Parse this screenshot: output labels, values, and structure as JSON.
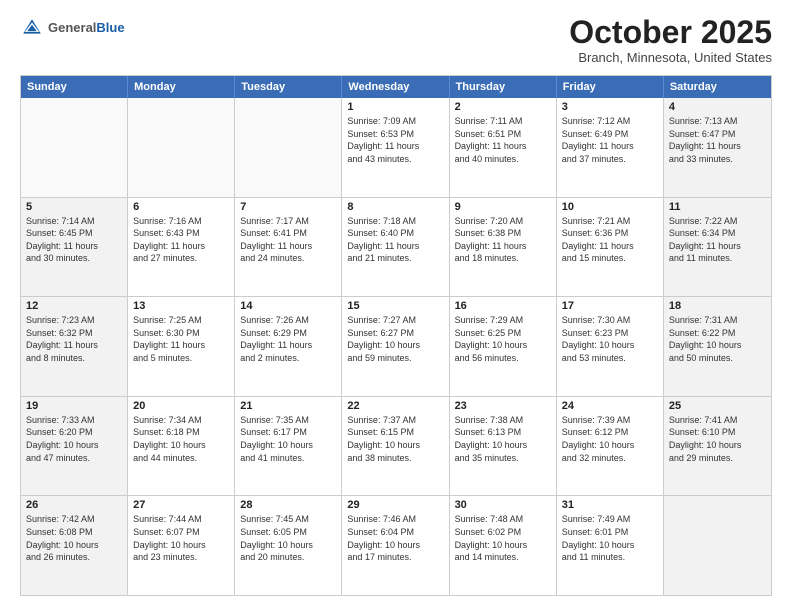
{
  "header": {
    "logo_general": "General",
    "logo_blue": "Blue",
    "month_title": "October 2025",
    "location": "Branch, Minnesota, United States"
  },
  "weekdays": [
    "Sunday",
    "Monday",
    "Tuesday",
    "Wednesday",
    "Thursday",
    "Friday",
    "Saturday"
  ],
  "rows": [
    [
      {
        "day": "",
        "text": "",
        "shaded": false,
        "empty": true
      },
      {
        "day": "",
        "text": "",
        "shaded": false,
        "empty": true
      },
      {
        "day": "",
        "text": "",
        "shaded": false,
        "empty": true
      },
      {
        "day": "1",
        "text": "Sunrise: 7:09 AM\nSunset: 6:53 PM\nDaylight: 11 hours\nand 43 minutes.",
        "shaded": false
      },
      {
        "day": "2",
        "text": "Sunrise: 7:11 AM\nSunset: 6:51 PM\nDaylight: 11 hours\nand 40 minutes.",
        "shaded": false
      },
      {
        "day": "3",
        "text": "Sunrise: 7:12 AM\nSunset: 6:49 PM\nDaylight: 11 hours\nand 37 minutes.",
        "shaded": false
      },
      {
        "day": "4",
        "text": "Sunrise: 7:13 AM\nSunset: 6:47 PM\nDaylight: 11 hours\nand 33 minutes.",
        "shaded": true
      }
    ],
    [
      {
        "day": "5",
        "text": "Sunrise: 7:14 AM\nSunset: 6:45 PM\nDaylight: 11 hours\nand 30 minutes.",
        "shaded": true
      },
      {
        "day": "6",
        "text": "Sunrise: 7:16 AM\nSunset: 6:43 PM\nDaylight: 11 hours\nand 27 minutes.",
        "shaded": false
      },
      {
        "day": "7",
        "text": "Sunrise: 7:17 AM\nSunset: 6:41 PM\nDaylight: 11 hours\nand 24 minutes.",
        "shaded": false
      },
      {
        "day": "8",
        "text": "Sunrise: 7:18 AM\nSunset: 6:40 PM\nDaylight: 11 hours\nand 21 minutes.",
        "shaded": false
      },
      {
        "day": "9",
        "text": "Sunrise: 7:20 AM\nSunset: 6:38 PM\nDaylight: 11 hours\nand 18 minutes.",
        "shaded": false
      },
      {
        "day": "10",
        "text": "Sunrise: 7:21 AM\nSunset: 6:36 PM\nDaylight: 11 hours\nand 15 minutes.",
        "shaded": false
      },
      {
        "day": "11",
        "text": "Sunrise: 7:22 AM\nSunset: 6:34 PM\nDaylight: 11 hours\nand 11 minutes.",
        "shaded": true
      }
    ],
    [
      {
        "day": "12",
        "text": "Sunrise: 7:23 AM\nSunset: 6:32 PM\nDaylight: 11 hours\nand 8 minutes.",
        "shaded": true
      },
      {
        "day": "13",
        "text": "Sunrise: 7:25 AM\nSunset: 6:30 PM\nDaylight: 11 hours\nand 5 minutes.",
        "shaded": false
      },
      {
        "day": "14",
        "text": "Sunrise: 7:26 AM\nSunset: 6:29 PM\nDaylight: 11 hours\nand 2 minutes.",
        "shaded": false
      },
      {
        "day": "15",
        "text": "Sunrise: 7:27 AM\nSunset: 6:27 PM\nDaylight: 10 hours\nand 59 minutes.",
        "shaded": false
      },
      {
        "day": "16",
        "text": "Sunrise: 7:29 AM\nSunset: 6:25 PM\nDaylight: 10 hours\nand 56 minutes.",
        "shaded": false
      },
      {
        "day": "17",
        "text": "Sunrise: 7:30 AM\nSunset: 6:23 PM\nDaylight: 10 hours\nand 53 minutes.",
        "shaded": false
      },
      {
        "day": "18",
        "text": "Sunrise: 7:31 AM\nSunset: 6:22 PM\nDaylight: 10 hours\nand 50 minutes.",
        "shaded": true
      }
    ],
    [
      {
        "day": "19",
        "text": "Sunrise: 7:33 AM\nSunset: 6:20 PM\nDaylight: 10 hours\nand 47 minutes.",
        "shaded": true
      },
      {
        "day": "20",
        "text": "Sunrise: 7:34 AM\nSunset: 6:18 PM\nDaylight: 10 hours\nand 44 minutes.",
        "shaded": false
      },
      {
        "day": "21",
        "text": "Sunrise: 7:35 AM\nSunset: 6:17 PM\nDaylight: 10 hours\nand 41 minutes.",
        "shaded": false
      },
      {
        "day": "22",
        "text": "Sunrise: 7:37 AM\nSunset: 6:15 PM\nDaylight: 10 hours\nand 38 minutes.",
        "shaded": false
      },
      {
        "day": "23",
        "text": "Sunrise: 7:38 AM\nSunset: 6:13 PM\nDaylight: 10 hours\nand 35 minutes.",
        "shaded": false
      },
      {
        "day": "24",
        "text": "Sunrise: 7:39 AM\nSunset: 6:12 PM\nDaylight: 10 hours\nand 32 minutes.",
        "shaded": false
      },
      {
        "day": "25",
        "text": "Sunrise: 7:41 AM\nSunset: 6:10 PM\nDaylight: 10 hours\nand 29 minutes.",
        "shaded": true
      }
    ],
    [
      {
        "day": "26",
        "text": "Sunrise: 7:42 AM\nSunset: 6:08 PM\nDaylight: 10 hours\nand 26 minutes.",
        "shaded": true
      },
      {
        "day": "27",
        "text": "Sunrise: 7:44 AM\nSunset: 6:07 PM\nDaylight: 10 hours\nand 23 minutes.",
        "shaded": false
      },
      {
        "day": "28",
        "text": "Sunrise: 7:45 AM\nSunset: 6:05 PM\nDaylight: 10 hours\nand 20 minutes.",
        "shaded": false
      },
      {
        "day": "29",
        "text": "Sunrise: 7:46 AM\nSunset: 6:04 PM\nDaylight: 10 hours\nand 17 minutes.",
        "shaded": false
      },
      {
        "day": "30",
        "text": "Sunrise: 7:48 AM\nSunset: 6:02 PM\nDaylight: 10 hours\nand 14 minutes.",
        "shaded": false
      },
      {
        "day": "31",
        "text": "Sunrise: 7:49 AM\nSunset: 6:01 PM\nDaylight: 10 hours\nand 11 minutes.",
        "shaded": false
      },
      {
        "day": "",
        "text": "",
        "shaded": true,
        "empty": true
      }
    ]
  ]
}
